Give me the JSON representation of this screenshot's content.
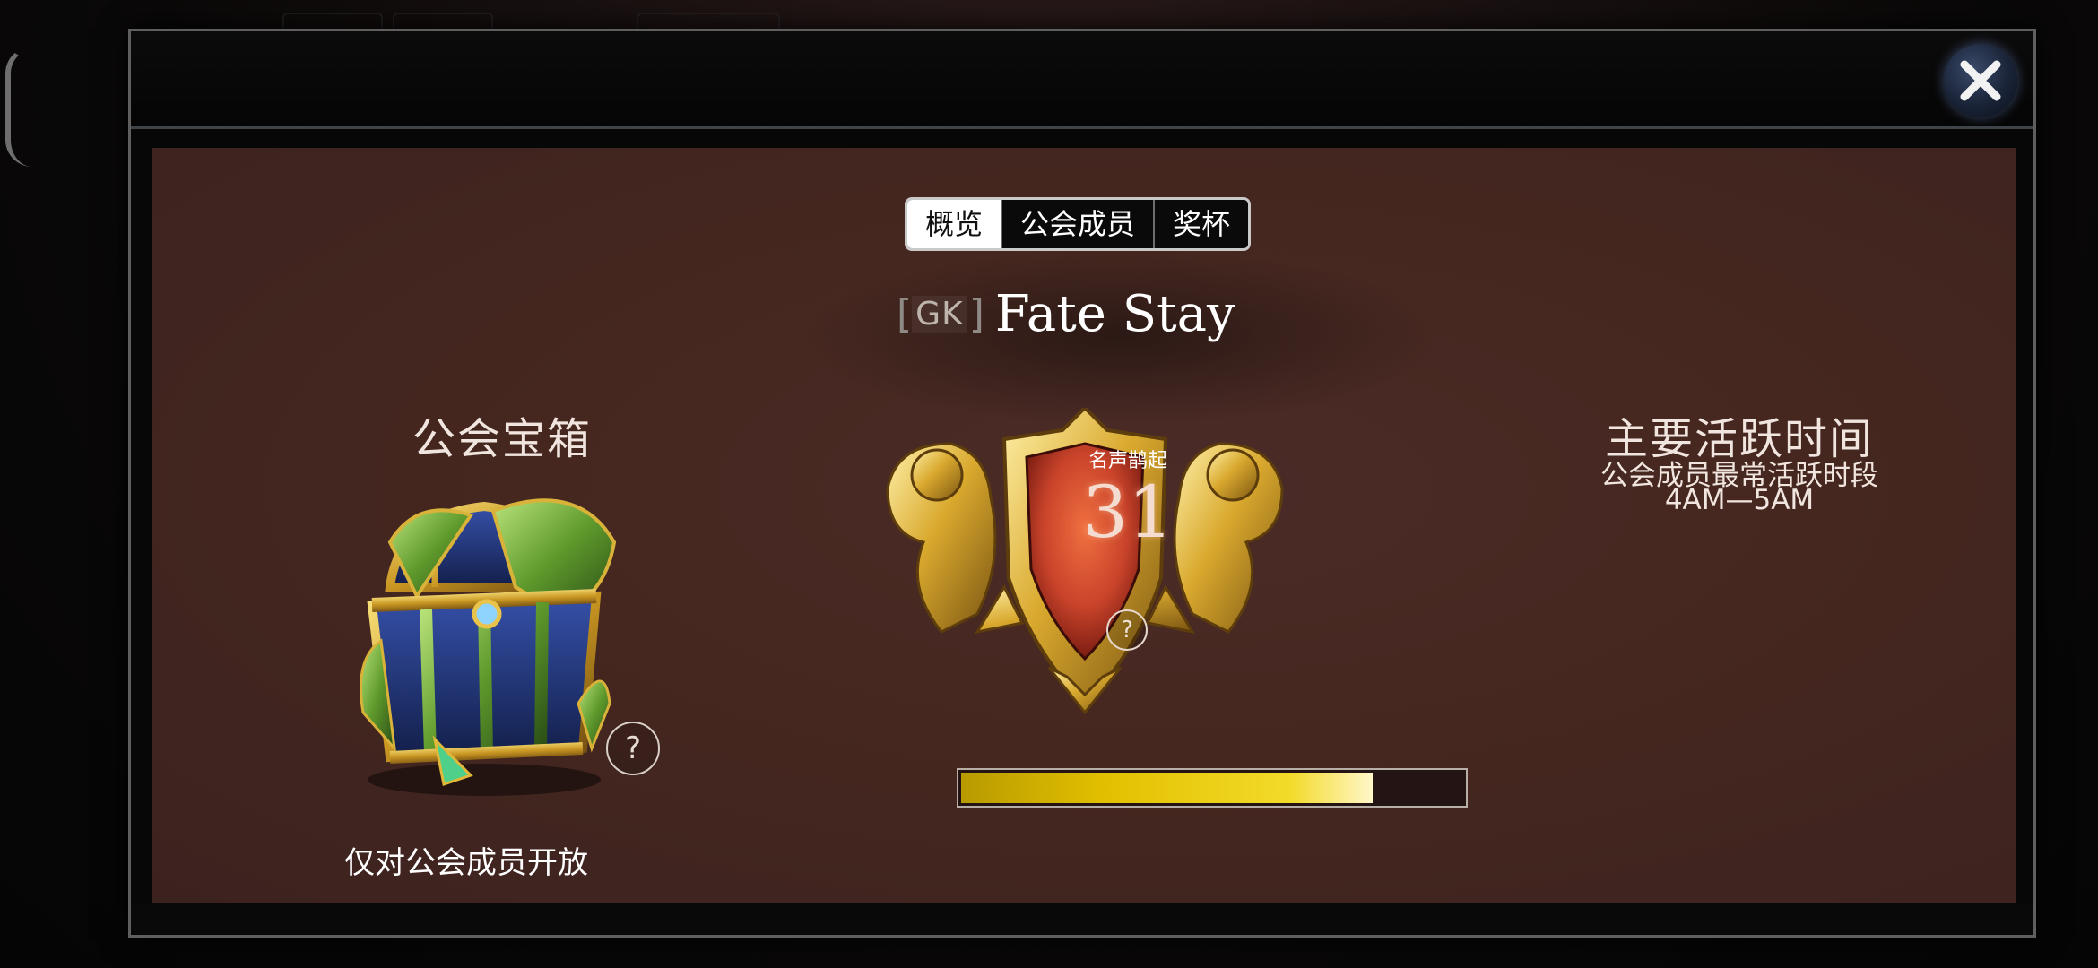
{
  "dialog": {
    "close_icon": "close-icon"
  },
  "tabs": [
    {
      "label": "概览",
      "active": true
    },
    {
      "label": "公会成员",
      "active": false
    },
    {
      "label": "奖杯",
      "active": false
    }
  ],
  "guild": {
    "tag": "GK",
    "name": "Fate Stay"
  },
  "chest": {
    "title": "公会宝箱",
    "help": "?",
    "note": "仅对公会成员开放"
  },
  "fame": {
    "label": "名声鹊起",
    "level": "31",
    "help": "?",
    "progress": 0.82,
    "bar_color": "#e2c000"
  },
  "activity": {
    "title": "主要活跃时间",
    "subtitle": "公会成员最常活跃时段",
    "range": "4AM—5AM"
  },
  "colors": {
    "panel": "#45271f",
    "frame": "#5f5f5f",
    "gold": "#d4a82a",
    "crest_red": "#c8432a"
  }
}
